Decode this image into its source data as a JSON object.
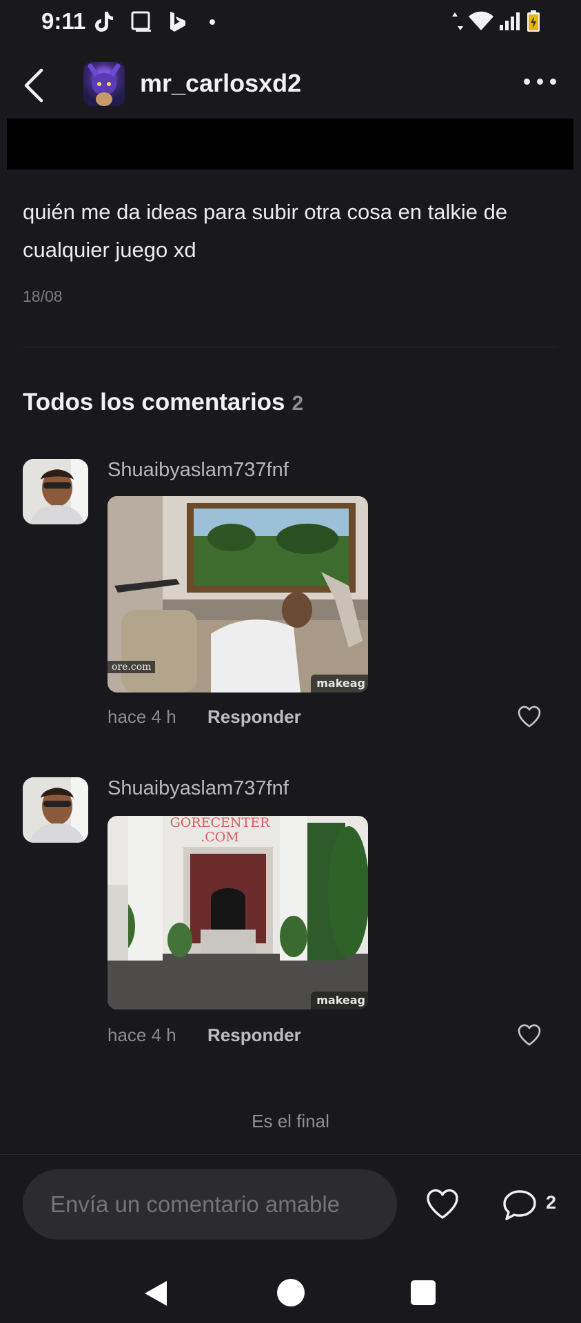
{
  "status_bar": {
    "time": "9:11",
    "left_icons": [
      "tiktok-icon",
      "square-icon",
      "bing-icon",
      "dot-icon"
    ],
    "right_icons": [
      "data-arrows-icon",
      "wifi-icon",
      "signal-icon",
      "battery-icon"
    ]
  },
  "header": {
    "username": "mr_carlosxd2",
    "back_icon": "chevron-left-icon",
    "more_icon": "more-horizontal-icon"
  },
  "post": {
    "text": "quién me da ideas para subir otra cosa en talkie de cualquier juego xd",
    "date": "18/08"
  },
  "comments_section": {
    "title": "Todos los comentarios",
    "count": "2"
  },
  "comments": [
    {
      "author": "Shuaibyaslam737fnf",
      "time": "hace 4 h",
      "reply_label": "Responder",
      "media_watermark_left": "ore.com",
      "media_watermark_right": "makeag"
    },
    {
      "author": "Shuaibyaslam737fnf",
      "time": "hace 4 h",
      "reply_label": "Responder",
      "media_caption": "GORECENTER\n.COM",
      "media_watermark_right": "makeag"
    }
  ],
  "end_text": "Es el final",
  "bottom_bar": {
    "input_placeholder": "Envía un comentario amable",
    "comment_count": "2"
  },
  "colors": {
    "background": "#19191d",
    "input_bg": "#2c2c30",
    "muted_text": "#8b8b90"
  }
}
